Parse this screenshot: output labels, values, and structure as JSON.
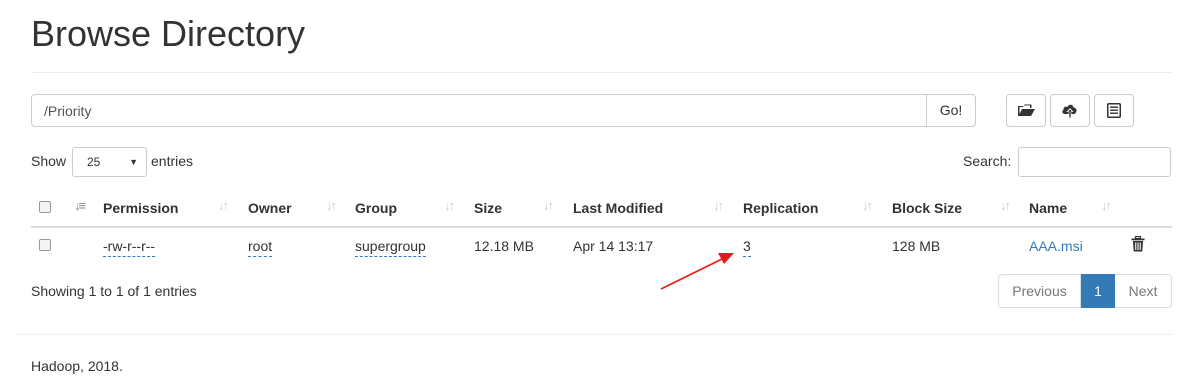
{
  "header": {
    "title": "Browse Directory"
  },
  "path_bar": {
    "value": "/Priority",
    "go_label": "Go!"
  },
  "toolbar": [
    {
      "icon": "folder-open-icon"
    },
    {
      "icon": "cloud-upload-icon"
    },
    {
      "icon": "list-alt-icon"
    }
  ],
  "length": {
    "show_label": "Show",
    "value": "25",
    "entries_label": "entries"
  },
  "search": {
    "label": "Search:",
    "value": ""
  },
  "table": {
    "columns": [
      "Permission",
      "Owner",
      "Group",
      "Size",
      "Last Modified",
      "Replication",
      "Block Size",
      "Name"
    ],
    "rows": [
      {
        "permission": "-rw-r--r--",
        "owner": "root",
        "group": "supergroup",
        "size": "12.18 MB",
        "last_modified": "Apr 14 13:17",
        "replication": "3",
        "block_size": "128 MB",
        "name": "AAA.msi"
      }
    ]
  },
  "info": "Showing 1 to 1 of 1 entries",
  "pagination": {
    "previous": "Previous",
    "current": "1",
    "next": "Next"
  },
  "footer": "Hadoop, 2018.",
  "colors": {
    "link": "#337ab7",
    "annotation_arrow": "#e31b1b"
  }
}
